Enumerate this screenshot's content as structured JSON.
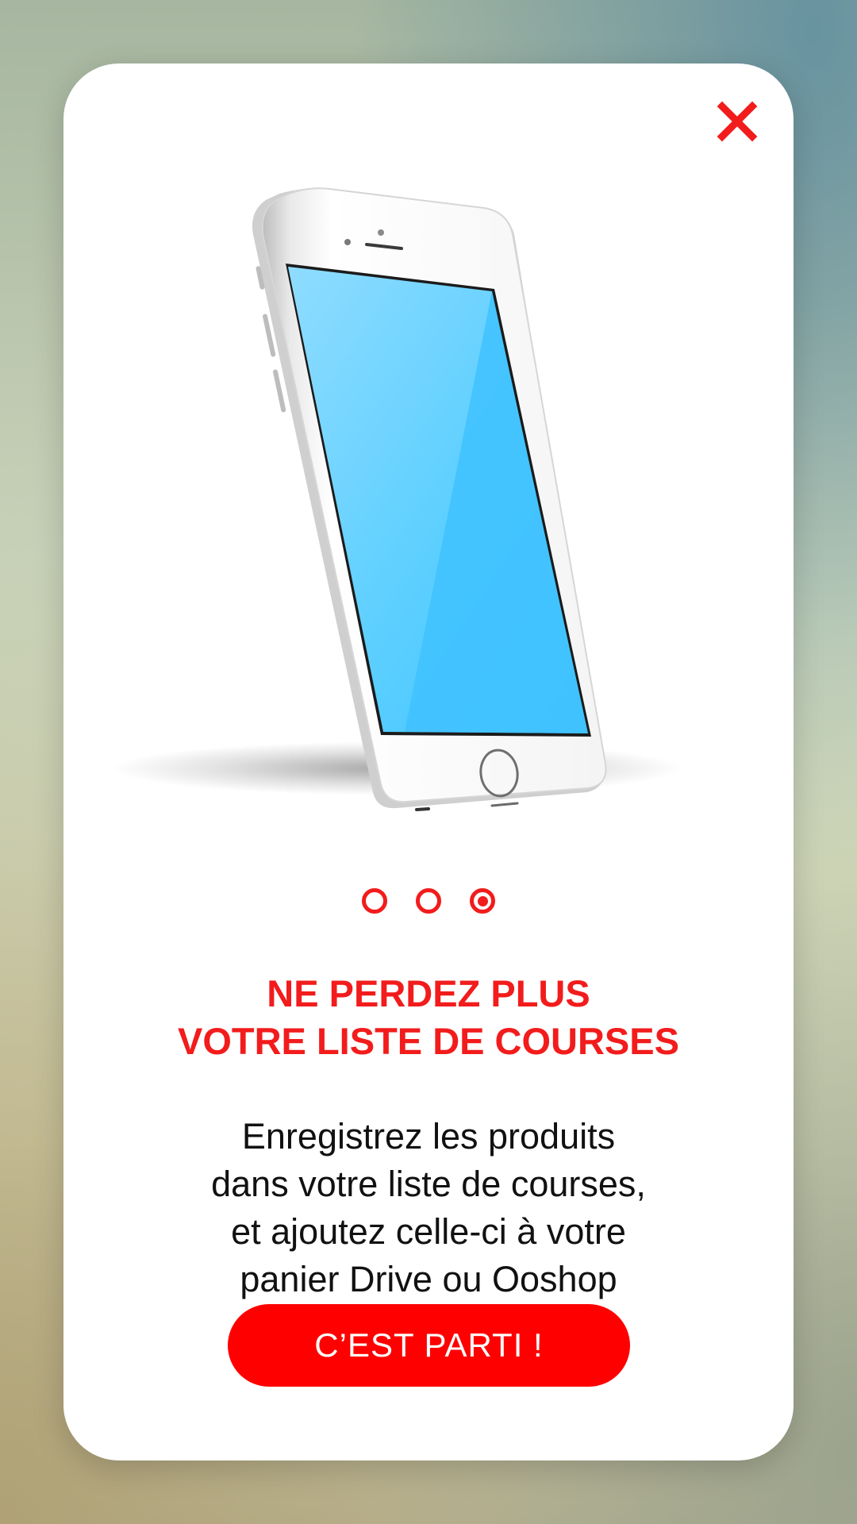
{
  "colors": {
    "accent": "#f21c1c",
    "button": "#fe0000",
    "text": "#111111",
    "screen": "#40c2ff"
  },
  "dialog": {
    "close_icon": "close-icon",
    "carousel": {
      "total": 3,
      "active_index": 2
    },
    "title_lines": [
      "NE PERDEZ PLUS",
      "VOTRE LISTE DE COURSES"
    ],
    "description_lines": [
      "Enregistrez les produits",
      "dans votre liste de courses,",
      "et ajoutez celle-ci à votre",
      "panier Drive ou Ooshop"
    ],
    "cta_label": "C’EST PARTI !"
  }
}
